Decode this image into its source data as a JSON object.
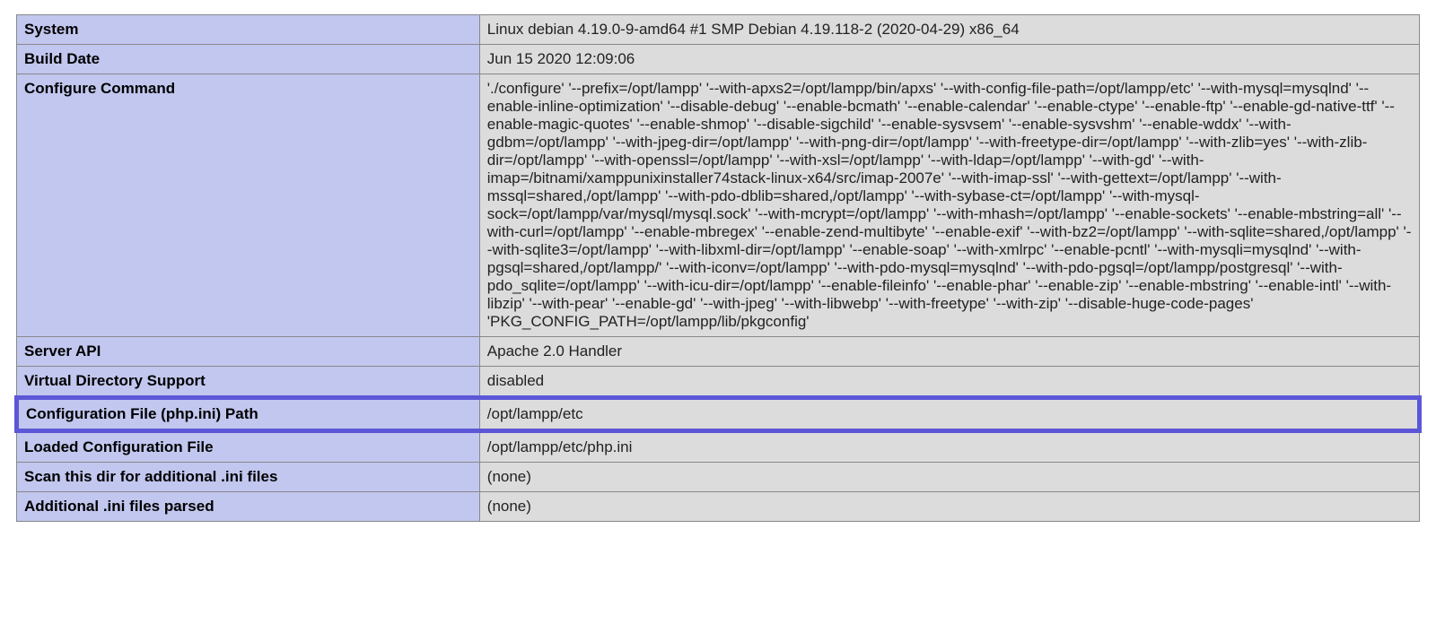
{
  "rows": [
    {
      "key": "System",
      "val": "Linux debian 4.19.0-9-amd64 #1 SMP Debian 4.19.118-2 (2020-04-29) x86_64",
      "highlighted": false
    },
    {
      "key": "Build Date",
      "val": "Jun 15 2020 12:09:06",
      "highlighted": false
    },
    {
      "key": "Configure Command",
      "val": "'./configure' '--prefix=/opt/lampp' '--with-apxs2=/opt/lampp/bin/apxs' '--with-config-file-path=/opt/lampp/etc' '--with-mysql=mysqlnd' '--enable-inline-optimization' '--disable-debug' '--enable-bcmath' '--enable-calendar' '--enable-ctype' '--enable-ftp' '--enable-gd-native-ttf' '--enable-magic-quotes' '--enable-shmop' '--disable-sigchild' '--enable-sysvsem' '--enable-sysvshm' '--enable-wddx' '--with-gdbm=/opt/lampp' '--with-jpeg-dir=/opt/lampp' '--with-png-dir=/opt/lampp' '--with-freetype-dir=/opt/lampp' '--with-zlib=yes' '--with-zlib-dir=/opt/lampp' '--with-openssl=/opt/lampp' '--with-xsl=/opt/lampp' '--with-ldap=/opt/lampp' '--with-gd' '--with-imap=/bitnami/xamppunixinstaller74stack-linux-x64/src/imap-2007e' '--with-imap-ssl' '--with-gettext=/opt/lampp' '--with-mssql=shared,/opt/lampp' '--with-pdo-dblib=shared,/opt/lampp' '--with-sybase-ct=/opt/lampp' '--with-mysql-sock=/opt/lampp/var/mysql/mysql.sock' '--with-mcrypt=/opt/lampp' '--with-mhash=/opt/lampp' '--enable-sockets' '--enable-mbstring=all' '--with-curl=/opt/lampp' '--enable-mbregex' '--enable-zend-multibyte' '--enable-exif' '--with-bz2=/opt/lampp' '--with-sqlite=shared,/opt/lampp' '--with-sqlite3=/opt/lampp' '--with-libxml-dir=/opt/lampp' '--enable-soap' '--with-xmlrpc' '--enable-pcntl' '--with-mysqli=mysqlnd' '--with-pgsql=shared,/opt/lampp/' '--with-iconv=/opt/lampp' '--with-pdo-mysql=mysqlnd' '--with-pdo-pgsql=/opt/lampp/postgresql' '--with-pdo_sqlite=/opt/lampp' '--with-icu-dir=/opt/lampp' '--enable-fileinfo' '--enable-phar' '--enable-zip' '--enable-mbstring' '--enable-intl' '--with-libzip' '--with-pear' '--enable-gd' '--with-jpeg' '--with-libwebp' '--with-freetype' '--with-zip' '--disable-huge-code-pages' 'PKG_CONFIG_PATH=/opt/lampp/lib/pkgconfig'",
      "highlighted": false
    },
    {
      "key": "Server API",
      "val": "Apache 2.0 Handler",
      "highlighted": false
    },
    {
      "key": "Virtual Directory Support",
      "val": "disabled",
      "highlighted": false
    },
    {
      "key": "Configuration File (php.ini) Path",
      "val": "/opt/lampp/etc",
      "highlighted": true
    },
    {
      "key": "Loaded Configuration File",
      "val": "/opt/lampp/etc/php.ini",
      "highlighted": false
    },
    {
      "key": "Scan this dir for additional .ini files",
      "val": "(none)",
      "highlighted": false
    },
    {
      "key": "Additional .ini files parsed",
      "val": "(none)",
      "highlighted": false
    }
  ]
}
